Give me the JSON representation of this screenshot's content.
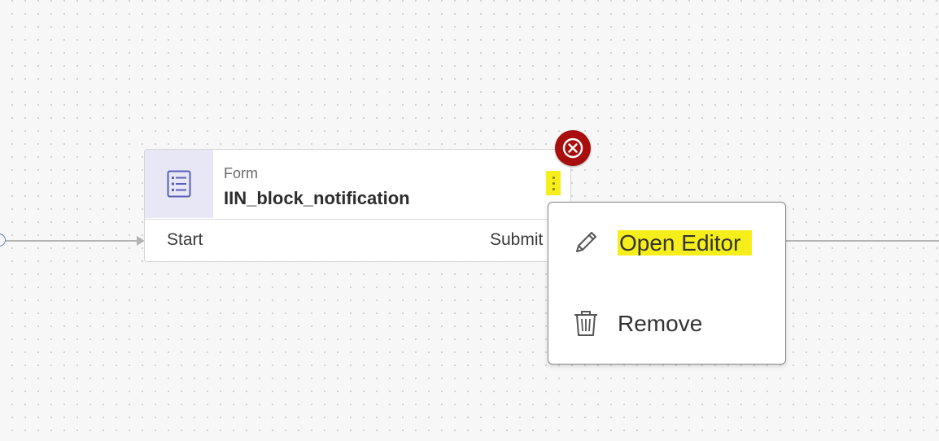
{
  "node": {
    "type_label": "Form",
    "name": "IIN_block_notification",
    "port_start": "Start",
    "port_submit": "Submit",
    "icon": "form-icon"
  },
  "error_badge": {
    "icon": "close-circle-icon",
    "color": "#a80e0e"
  },
  "context_menu": {
    "items": [
      {
        "label": "Open Editor",
        "icon": "pencil-icon",
        "highlighted": true
      },
      {
        "label": "Remove",
        "icon": "trash-icon",
        "highlighted": false
      }
    ]
  },
  "colors": {
    "canvas": "#f7f7f7",
    "highlight": "#f5ee1a",
    "icon_box": "#e7e7f6",
    "icon_stroke": "#5a5fb8"
  }
}
